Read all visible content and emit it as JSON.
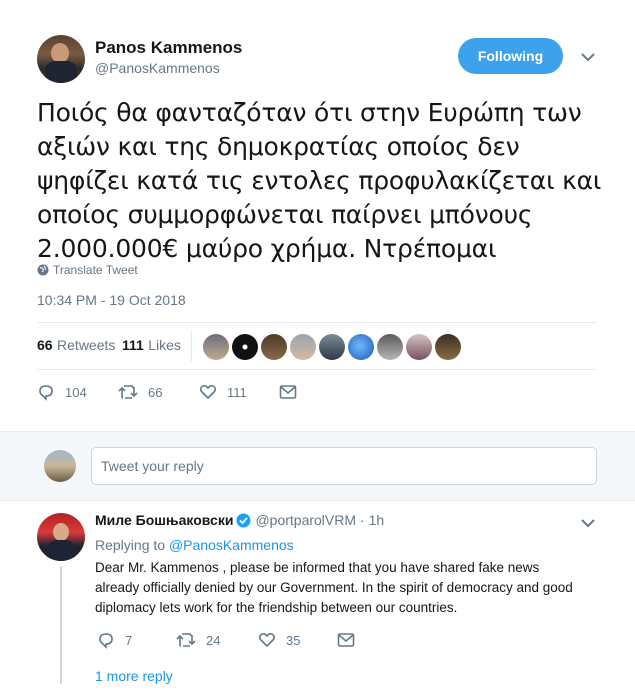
{
  "author": {
    "name": "Panos Kammenos",
    "handle": "@PanosKammenos",
    "follow_label": "Following"
  },
  "tweet": {
    "text": "Ποιός θα φανταζόταν ότι στην Ευρώπη των αξιών και της δημοκρατίας οποίος δεν ψηφίζει κατά τις εντολες προφυλακίζεται και οποίος συμμορφώνεται παίρνει μπόνους 2.000.000€ μαύρο χρήμα. Ντρέπομαι",
    "lines": [
      "Ποιός θα φανταζόταν ότι στην Ευρώπη των",
      "αξιών και της δημοκρατίας οποίος δεν",
      "ψηφίζει κατά τις εντολες προφυλακίζεται και",
      "οποίος συμμορφώνεται παίρνει μπόνους",
      "2.000.000€ μαύρο χρήμα. Ντρέπομαι"
    ],
    "translate_label": "Translate Tweet",
    "timestamp": "10:34 PM - 19 Oct 2018",
    "retweets_count": "66",
    "retweets_label": "Retweets",
    "likes_count": "111",
    "likes_label": "Likes",
    "actions": {
      "reply_count": "104",
      "retweet_count": "66",
      "like_count": "111"
    }
  },
  "reply_box": {
    "placeholder": "Tweet your reply"
  },
  "reply": {
    "name": "Миле Бошњаковски",
    "handle": "@portparolVRM",
    "time": "· 1h",
    "replying_to_label": "Replying to",
    "replying_to_handle": "@PanosKammenos",
    "text_lines": [
      "Dear Mr. Kammenos , please be informed that you have shared fake news",
      "already officially denied by our Government. In the spirit of democracy and good",
      "diplomacy lets work for the friendship between our countries."
    ],
    "actions": {
      "reply_count": "7",
      "retweet_count": "24",
      "like_count": "35"
    },
    "more_replies": "1 more reply"
  },
  "colors": {
    "accent": "#3ea1ec",
    "link": "#1b95e0",
    "muted": "#657786",
    "verified": "#1da1f2"
  }
}
